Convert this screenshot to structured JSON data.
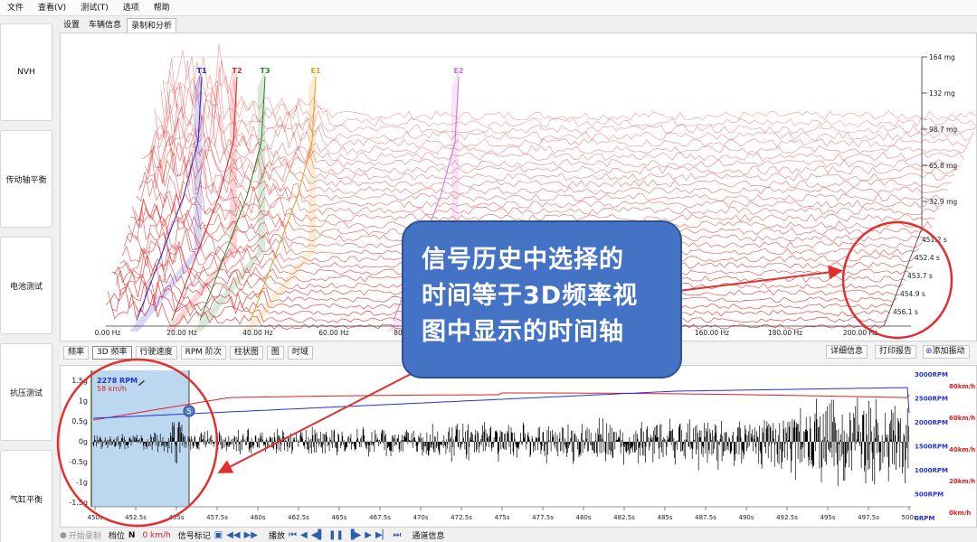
{
  "menu": [
    "文件",
    "查看(V)",
    "测试(T)",
    "选项",
    "帮助"
  ],
  "nav": [
    "NVH",
    "传动轴平衡",
    "电池测试",
    "抗压测试",
    "气缸平衡"
  ],
  "tabs": [
    {
      "label": "设置",
      "active": false
    },
    {
      "label": "车辆信息",
      "active": false
    },
    {
      "label": "录制和分析",
      "active": true
    }
  ],
  "spectrum": {
    "x_ticks": [
      "0.00 Hz",
      "20.00 Hz",
      "40.00 Hz",
      "60.00 Hz",
      "80.00 Hz",
      "160.00 Hz",
      "180.00 Hz",
      "200.00 Hz"
    ],
    "amp_ticks": [
      "164 mg",
      "132 mg",
      "98.7 mg",
      "65.8 mg",
      "32.9 mg"
    ],
    "time_ticks": [
      "451.2 s",
      "452.4 s",
      "453.7 s",
      "454.9 s",
      "456.1 s"
    ],
    "markers": [
      {
        "label": "T1",
        "color": "#2222cc"
      },
      {
        "label": "T2",
        "color": "#dd2222"
      },
      {
        "label": "T3",
        "color": "#22882a"
      },
      {
        "label": "E1",
        "color": "#e89a1a"
      },
      {
        "label": "E2",
        "color": "#d070d0"
      }
    ]
  },
  "toolbar": {
    "left": [
      "频率",
      "3D 频率",
      "行驶速度",
      "RPM 阶次",
      "柱状图",
      "图",
      "时域"
    ],
    "selected": "3D 频率",
    "right": [
      "详细信息",
      "打印报告",
      "添加振动"
    ]
  },
  "signal": {
    "y_ticks_left": [
      "1.5g",
      "1g",
      "0.5g",
      "0g",
      "-0.5g",
      "-1g",
      "-1.5g"
    ],
    "y_ticks_rpm": [
      "3000RPM",
      "2500RPM",
      "2000RPM",
      "1500RPM",
      "1000RPM",
      "500RPM",
      "0RPM"
    ],
    "y_ticks_kmh": [
      "80km/h",
      "60km/h",
      "40km/h",
      "20km/h",
      "0km/h"
    ],
    "x_ticks": [
      "450s",
      "452.5s",
      "455s",
      "457.5s",
      "460s",
      "462.5s",
      "465s",
      "467.5s",
      "470s",
      "472.5s",
      "475s",
      "477.5s",
      "480s",
      "482.5s",
      "485s",
      "487.5s",
      "490s",
      "492.5s",
      "495s",
      "497.5s",
      "500s"
    ],
    "rpm_readout": "2278 RPM",
    "speed_readout": "58 km/h",
    "marker_number": "5",
    "rpm_color": "#2233dd",
    "speed_color": "#dd2222"
  },
  "status": {
    "record": "开始录制",
    "n_label": "档位",
    "gear": "N",
    "speed": "0 km/h",
    "signal_marker": "信号标记",
    "playback": "播放",
    "channel_info": "通道信息"
  },
  "callout": {
    "lines": [
      "信号历史中选择的",
      "时间等于3D频率视",
      "图中显示的时间轴"
    ],
    "color": "#4472c4"
  }
}
